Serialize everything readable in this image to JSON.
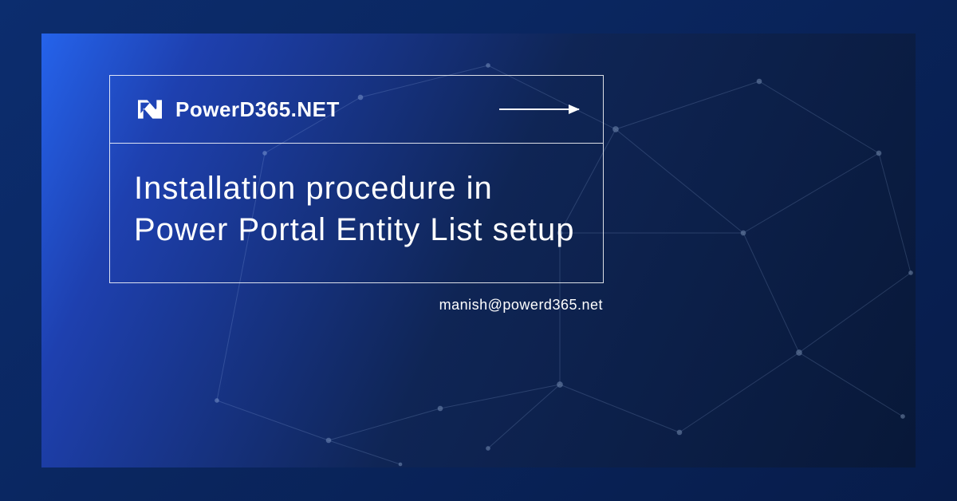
{
  "brand": {
    "name": "PowerD365.NET"
  },
  "content": {
    "title": "Installation procedure in Power Portal Entity List setup"
  },
  "contact": {
    "email": "manish@powerd365.net"
  }
}
